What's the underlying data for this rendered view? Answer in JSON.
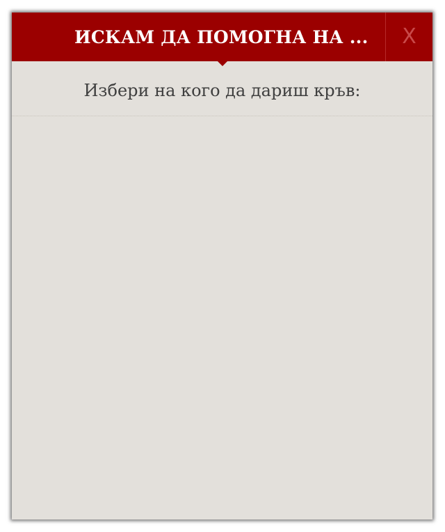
{
  "dialog": {
    "title": "ИСКАМ ДА ПОМОГНА НА ...",
    "close_label": "X",
    "prompt": "Избери на кого да дариш кръв:"
  },
  "colors": {
    "header_bg": "#9b0000",
    "body_bg": "#e3e0db",
    "title_text": "#ffffff",
    "prompt_text": "#3f3f3f"
  }
}
